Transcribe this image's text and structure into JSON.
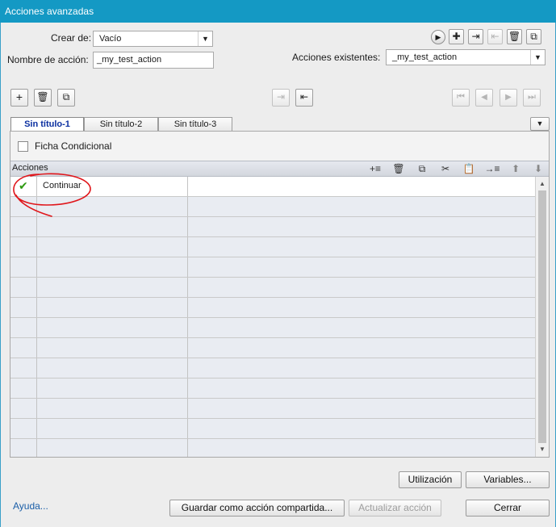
{
  "window": {
    "title": "Acciones avanzadas"
  },
  "form": {
    "create_from_label": "Crear de:",
    "create_from_value": "Vacío",
    "action_name_label": "Nombre de acción:",
    "action_name_value": "_my_test_action",
    "existing_label": "Acciones existentes:",
    "existing_value": "_my_test_action"
  },
  "tabs": [
    {
      "label": "Sin título-1",
      "active": true
    },
    {
      "label": "Sin título-2",
      "active": false
    },
    {
      "label": "Sin título-3",
      "active": false
    }
  ],
  "conditional": {
    "label": "Ficha Condicional",
    "checked": false
  },
  "actions_panel": {
    "header": "Acciones",
    "rows": [
      {
        "status_icon": "checkmark-icon",
        "action": "Continuar",
        "detail": ""
      }
    ],
    "empty_rows": 13
  },
  "buttons": {
    "usage": "Utilización",
    "variables": "Variables...",
    "help": "Ayuda...",
    "save_shared": "Guardar como acción compartida...",
    "update": "Actualizar acción",
    "close": "Cerrar"
  },
  "colors": {
    "title_bar": "#1499c4",
    "active_tab_text": "#0b2fa0",
    "help_link": "#1a5ea8",
    "annotation": "#e0161b",
    "checkmark": "#2e9a12"
  }
}
